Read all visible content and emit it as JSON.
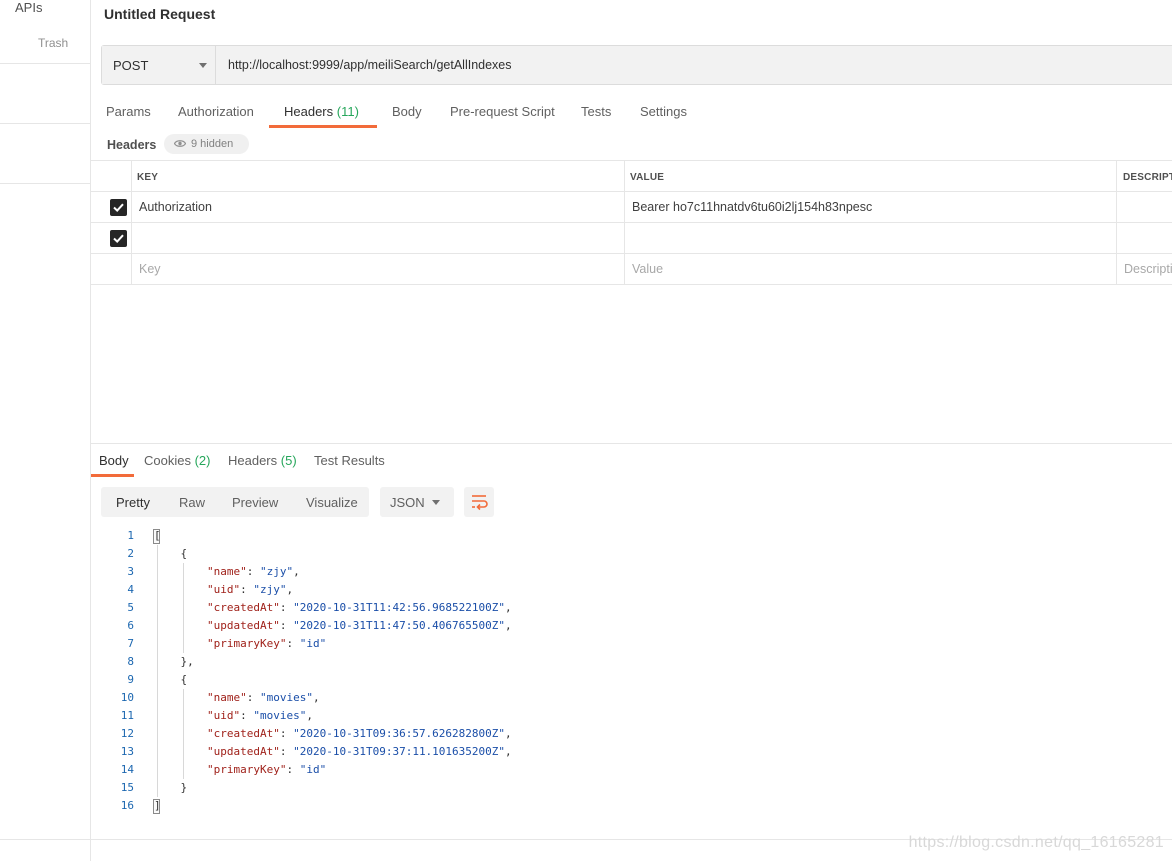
{
  "sidebar": {
    "apis_label": "APIs",
    "trash_label": "Trash"
  },
  "request": {
    "title": "Untitled Request",
    "method": "POST",
    "url": "http://localhost:9999/app/meiliSearch/getAllIndexes"
  },
  "request_tabs": [
    {
      "label": "Params"
    },
    {
      "label": "Authorization"
    },
    {
      "label": "Headers",
      "count": "(11)",
      "active": true
    },
    {
      "label": "Body"
    },
    {
      "label": "Pre-request Script"
    },
    {
      "label": "Tests"
    },
    {
      "label": "Settings"
    }
  ],
  "headers_section": {
    "title": "Headers",
    "hidden_label": "9 hidden"
  },
  "headers_table": {
    "columns": {
      "key": "KEY",
      "value": "VALUE",
      "description": "DESCRIPTI"
    },
    "rows": [
      {
        "checked": true,
        "key": "Authorization",
        "value": "Bearer ho7c11hnatdv6tu60i2lj154h83npesc"
      },
      {
        "checked": true,
        "key": "",
        "value": ""
      }
    ],
    "placeholders": {
      "key": "Key",
      "value": "Value",
      "description": "Descripti"
    }
  },
  "response_tabs": [
    {
      "label": "Body",
      "active": true
    },
    {
      "label": "Cookies",
      "count": "(2)"
    },
    {
      "label": "Headers",
      "count": "(5)"
    },
    {
      "label": "Test Results"
    }
  ],
  "format_options": [
    {
      "label": "Pretty",
      "active": true
    },
    {
      "label": "Raw"
    },
    {
      "label": "Preview"
    },
    {
      "label": "Visualize"
    }
  ],
  "language": "JSON",
  "response_body": [
    {
      "n": "1",
      "indent": 0,
      "text": "["
    },
    {
      "n": "2",
      "indent": 1,
      "text": "{"
    },
    {
      "n": "3",
      "indent": 2,
      "key": "name",
      "value": "zjy",
      "comma": true
    },
    {
      "n": "4",
      "indent": 2,
      "key": "uid",
      "value": "zjy",
      "comma": true
    },
    {
      "n": "5",
      "indent": 2,
      "key": "createdAt",
      "value": "2020-10-31T11:42:56.968522100Z",
      "comma": true
    },
    {
      "n": "6",
      "indent": 2,
      "key": "updatedAt",
      "value": "2020-10-31T11:47:50.406765500Z",
      "comma": true
    },
    {
      "n": "7",
      "indent": 2,
      "key": "primaryKey",
      "value": "id",
      "comma": false
    },
    {
      "n": "8",
      "indent": 1,
      "text": "},"
    },
    {
      "n": "9",
      "indent": 1,
      "text": "{"
    },
    {
      "n": "10",
      "indent": 2,
      "key": "name",
      "value": "movies",
      "comma": true
    },
    {
      "n": "11",
      "indent": 2,
      "key": "uid",
      "value": "movies",
      "comma": true
    },
    {
      "n": "12",
      "indent": 2,
      "key": "createdAt",
      "value": "2020-10-31T09:36:57.626282800Z",
      "comma": true
    },
    {
      "n": "13",
      "indent": 2,
      "key": "updatedAt",
      "value": "2020-10-31T09:37:11.101635200Z",
      "comma": true
    },
    {
      "n": "14",
      "indent": 2,
      "key": "primaryKey",
      "value": "id",
      "comma": false
    },
    {
      "n": "15",
      "indent": 1,
      "text": "}"
    },
    {
      "n": "16",
      "indent": 0,
      "text": "]"
    }
  ],
  "watermark": "https://blog.csdn.net/qq_16165281",
  "colors": {
    "accent": "#f26b3a",
    "count_green": "#26a65b",
    "json_key": "#a0221b",
    "json_string": "#1a4ea8",
    "line_number": "#1c67b0"
  }
}
